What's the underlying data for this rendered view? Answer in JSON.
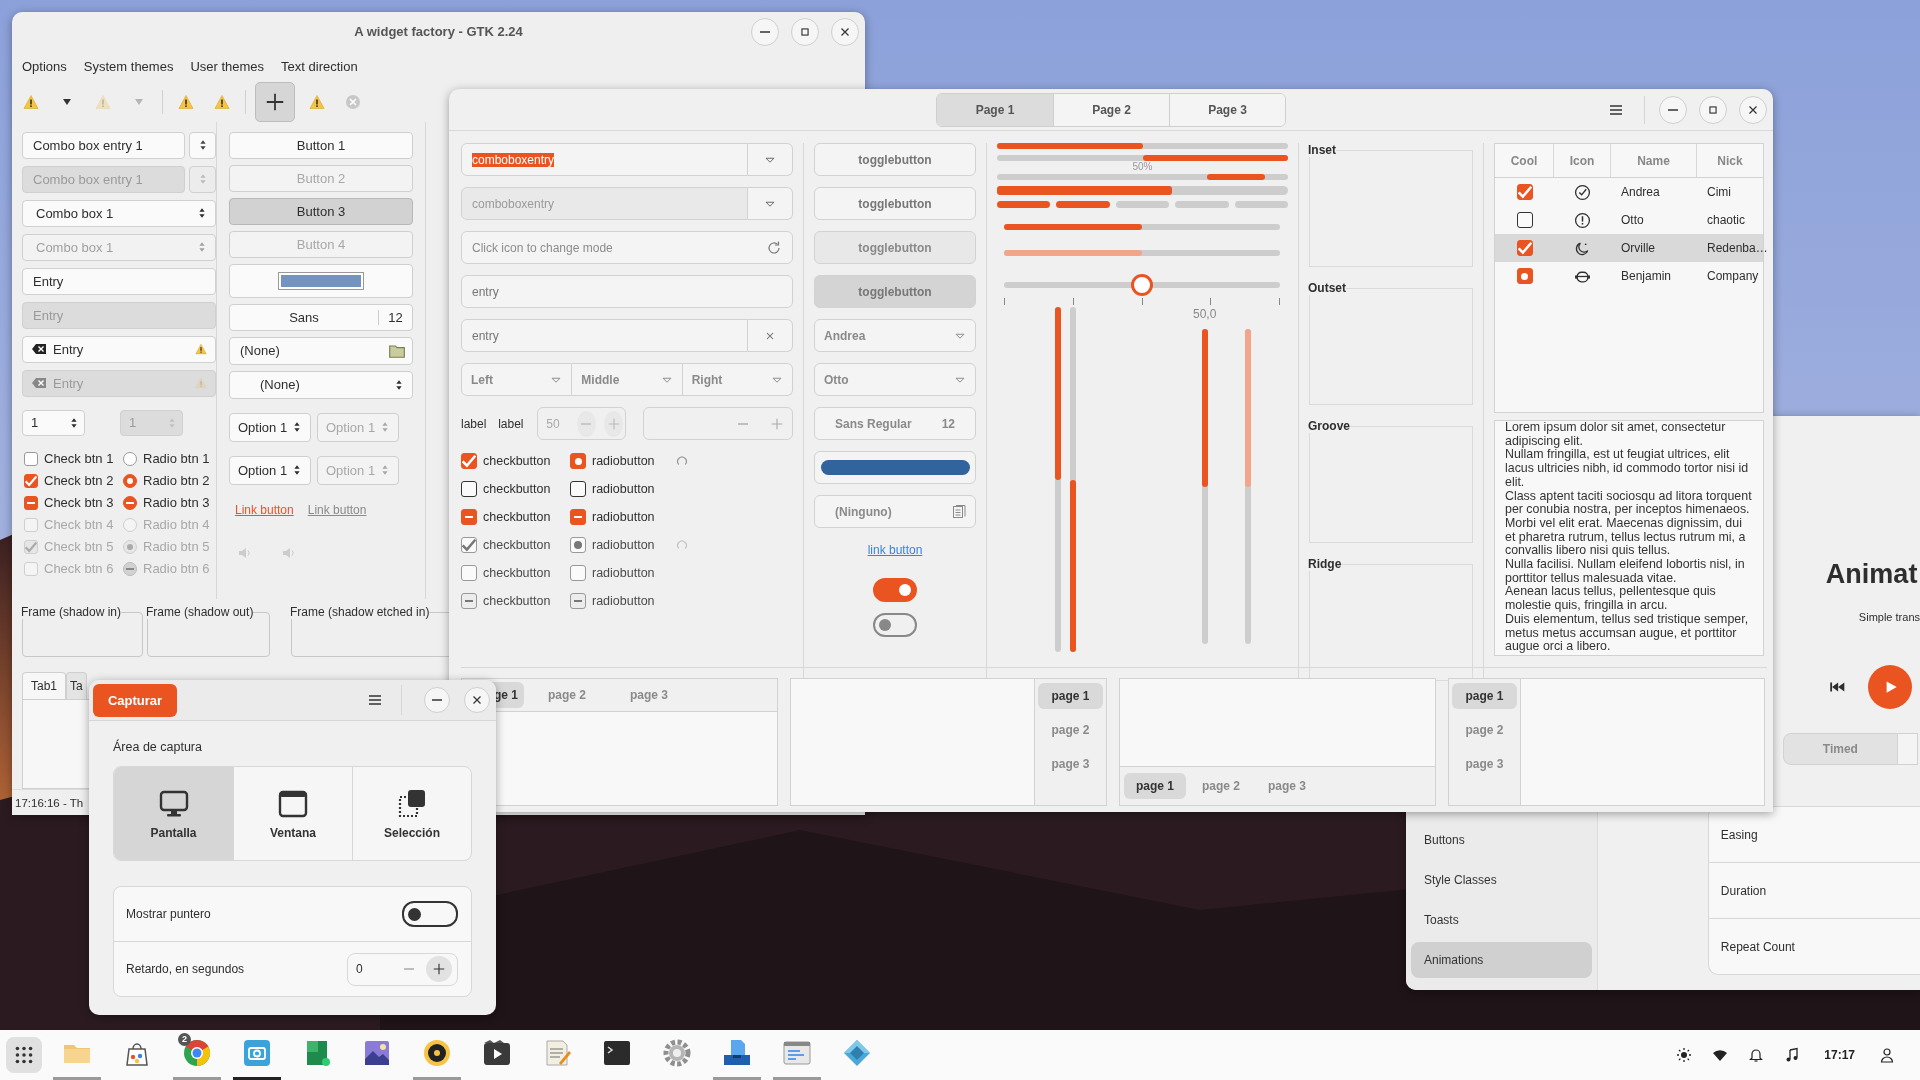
{
  "side_window": {
    "sidebar": [
      {
        "label": "Buttons",
        "selected": false
      },
      {
        "label": "Style Classes",
        "selected": false
      },
      {
        "label": "Toasts",
        "selected": false
      },
      {
        "label": "Animations",
        "selected": true
      }
    ],
    "heading": "Animat",
    "subtitle": "Simple trans",
    "segments": [
      {
        "label": "Timed",
        "selected": true
      }
    ],
    "rows": [
      "Easing",
      "Duration",
      "Repeat Count"
    ]
  },
  "gtk2_window": {
    "title": "A widget factory - GTK 2.24",
    "menu": [
      "Options",
      "System themes",
      "User themes",
      "Text direction"
    ],
    "toolbar": [
      {
        "items": [
          {
            "kind": "warning",
            "disabled": false,
            "pressed": false
          },
          {
            "kind": "arrow",
            "disabled": false,
            "pressed": false
          },
          {
            "kind": "warning",
            "disabled": true,
            "pressed": false
          },
          {
            "kind": "arrow",
            "disabled": true,
            "pressed": false
          }
        ]
      },
      {
        "items": [
          {
            "kind": "warning",
            "disabled": false,
            "pressed": false
          },
          {
            "kind": "warning",
            "disabled": false,
            "pressed": false
          }
        ]
      },
      {
        "items": [
          {
            "kind": "add",
            "disabled": false,
            "pressed": true
          },
          {
            "kind": "warning",
            "disabled": false,
            "pressed": false
          },
          {
            "kind": "stop",
            "disabled": false,
            "pressed": false
          }
        ]
      }
    ],
    "fields": [
      {
        "kind": "combo_entry",
        "value": "Combo box entry 1",
        "disabled": false
      },
      {
        "kind": "combo_entry",
        "value": "Combo box entry 1",
        "disabled": true
      },
      {
        "kind": "combo",
        "value": "Combo box 1",
        "disabled": false
      },
      {
        "kind": "combo",
        "value": "Combo box 1",
        "disabled": true
      },
      {
        "kind": "entry",
        "value": "Entry",
        "disabled": false
      },
      {
        "kind": "entry",
        "value": "Entry",
        "disabled": true
      },
      {
        "kind": "icon_entry",
        "value": "Entry",
        "disabled": false
      },
      {
        "kind": "icon_entry",
        "value": "Entry",
        "disabled": true
      }
    ],
    "spins": [
      {
        "value": "1",
        "disabled": false
      },
      {
        "value": "1",
        "disabled": true
      }
    ],
    "checks": [
      {
        "kind": "plain",
        "label": "Check btn 1",
        "checked": false,
        "disabled": false
      },
      {
        "kind": "plain",
        "label": "Check btn 2",
        "checked": true,
        "disabled": false
      },
      {
        "kind": "mixed",
        "label": "Check btn 3",
        "checked": true,
        "disabled": false
      },
      {
        "kind": "plain",
        "label": "Check btn 4",
        "checked": false,
        "disabled": true
      },
      {
        "kind": "plain",
        "label": "Check btn 5",
        "checked": true,
        "disabled": true
      },
      {
        "kind": "plain",
        "label": "Check btn 6",
        "checked": false,
        "disabled": true
      }
    ],
    "radios": [
      {
        "kind": "plain",
        "label": "Radio btn 1",
        "selected": false,
        "disabled": false
      },
      {
        "kind": "plain",
        "label": "Radio btn 2",
        "selected": true,
        "disabled": false
      },
      {
        "kind": "mixed",
        "label": "Radio btn 3",
        "selected": true,
        "disabled": false
      },
      {
        "kind": "plain",
        "label": "Radio btn 4",
        "selected": false,
        "disabled": true
      },
      {
        "kind": "plain",
        "label": "Radio btn 5",
        "selected": true,
        "disabled": true
      },
      {
        "kind": "mixed",
        "label": "Radio btn 6",
        "selected": true,
        "disabled": true
      }
    ],
    "buttons": [
      {
        "label": "Button 1",
        "disabled": false,
        "pressed": false
      },
      {
        "label": "Button 2",
        "disabled": true,
        "pressed": false
      },
      {
        "label": "Button 3",
        "disabled": false,
        "pressed": true
      },
      {
        "label": "Button 4",
        "disabled": true,
        "pressed": false
      }
    ],
    "font_button": {
      "family": "Sans",
      "size": "12"
    },
    "file_button": {
      "value": "(None)"
    },
    "combo": {
      "value": "(None)"
    },
    "option_spins": [
      {
        "value": "Option 1",
        "disabled": false
      },
      {
        "value": "Option 1",
        "disabled": true
      },
      {
        "value": "Option 1",
        "disabled": false
      },
      {
        "value": "Option 1",
        "disabled": true
      }
    ],
    "links": [
      {
        "label": "Link button",
        "visited": false
      },
      {
        "label": "Link button",
        "visited": true
      }
    ],
    "frames": [
      "Frame (shadow in)",
      "Frame (shadow out)",
      "Frame (shadow etched in)"
    ],
    "tabs": [
      {
        "label": "Tab1",
        "selected": true
      },
      {
        "label": "Ta",
        "selected": false
      }
    ],
    "status": "17:16:16 - Th"
  },
  "main_window": {
    "tabs": [
      {
        "label": "Page 1",
        "selected": true
      },
      {
        "label": "Page 2",
        "selected": false
      },
      {
        "label": "Page 3",
        "selected": false
      }
    ],
    "entries": [
      {
        "kind": "combo_entry",
        "value": "comboboxentry",
        "highlighted": true,
        "disabled": false
      },
      {
        "kind": "combo_entry",
        "value": "comboboxentry",
        "highlighted": false,
        "disabled": true
      },
      {
        "kind": "icon_entry",
        "placeholder": "Click icon to change mode",
        "disabled": false
      },
      {
        "kind": "entry",
        "placeholder": "entry",
        "disabled": false
      },
      {
        "kind": "clear_entry",
        "placeholder": "entry",
        "disabled": false
      }
    ],
    "linked_combos": [
      "Left",
      "Middle",
      "Right"
    ],
    "labels": [
      "label",
      "label"
    ],
    "spins": [
      {
        "value": "50",
        "disabled": true
      },
      {
        "disabled": true
      }
    ],
    "rows": [
      {
        "check": {
          "kind": "plain",
          "label": "checkbutton",
          "checked": true,
          "disabled": false
        },
        "radio": {
          "kind": "plain",
          "label": "radiobutton",
          "selected": true,
          "disabled": false
        },
        "spinner": true
      },
      {
        "check": {
          "kind": "plain",
          "label": "checkbutton",
          "checked": false,
          "disabled": false
        },
        "radio": {
          "kind": "plain",
          "label": "radiobutton",
          "selected": false,
          "disabled": false
        },
        "spinner": false
      },
      {
        "check": {
          "kind": "mixed",
          "label": "checkbutton",
          "checked": true,
          "disabled": false
        },
        "radio": {
          "kind": "mixed",
          "label": "radiobutton",
          "selected": true,
          "disabled": false
        },
        "spinner": false
      },
      {
        "check": {
          "kind": "plain",
          "label": "checkbutton",
          "checked": true,
          "disabled": true
        },
        "radio": {
          "kind": "plain",
          "label": "radiobutton",
          "selected": true,
          "disabled": true
        },
        "spinner": true
      },
      {
        "check": {
          "kind": "plain",
          "label": "checkbutton",
          "checked": false,
          "disabled": true
        },
        "radio": {
          "kind": "plain",
          "label": "radiobutton",
          "selected": false,
          "disabled": true
        },
        "spinner": false
      },
      {
        "check": {
          "kind": "mixed",
          "label": "checkbutton",
          "checked": true,
          "disabled": true
        },
        "radio": {
          "kind": "mixed",
          "label": "radiobutton",
          "selected": true,
          "disabled": true
        },
        "spinner": false
      }
    ],
    "toggles": [
      {
        "label": "togglebutton",
        "active": false,
        "disabled": false
      },
      {
        "label": "togglebutton",
        "active": false,
        "disabled": false
      },
      {
        "label": "togglebutton",
        "active": true,
        "disabled": true
      },
      {
        "label": "togglebutton",
        "active": true,
        "disabled": false
      }
    ],
    "combos": [
      "Andrea",
      "Otto"
    ],
    "font_button": {
      "family": "Sans Regular",
      "size": "12"
    },
    "file_button": {
      "value": "(Ninguno)"
    },
    "link": "link button",
    "switches": [
      {
        "on": true
      },
      {
        "on": false
      }
    ],
    "progress_bars": [
      {
        "level": 0.5,
        "inverted": false
      },
      {
        "level": 0.5,
        "inverted": true
      }
    ],
    "pulse_bar": {
      "label": "50%"
    },
    "wide_bar": {
      "level": 0.6
    },
    "segmented_bar": {
      "level": 0.4
    },
    "scales": [
      {
        "level": 0.5,
        "disabled": false
      },
      {
        "level": 0.5,
        "disabled": true
      }
    ],
    "slider": {
      "level": 0.5
    },
    "vertical_scales": [
      {
        "level": 0.5,
        "inverted": false,
        "disabled": false
      },
      {
        "level": 0.5,
        "inverted": true,
        "disabled": false
      },
      {
        "level": 0.5,
        "inverted": false,
        "disabled": false,
        "value": "50,0"
      },
      {
        "level": 0.5,
        "inverted": false,
        "disabled": true
      }
    ],
    "frames": [
      "Inset",
      "Outset",
      "Groove",
      "Ridge"
    ],
    "tree": {
      "columns": [
        "Cool",
        "Icon",
        "Name",
        "Nick"
      ],
      "rows": [
        {
          "kind": "check",
          "checked": true,
          "name": "Andrea",
          "nick": "Cimi",
          "selected": false
        },
        {
          "kind": "check",
          "checked": false,
          "name": "Otto",
          "nick": "chaotic",
          "selected": false
        },
        {
          "kind": "check",
          "checked": true,
          "name": "Orville",
          "nick": "Redenba…",
          "selected": true
        },
        {
          "kind": "radio",
          "checked": true,
          "name": "Benjamin",
          "nick": "Company",
          "selected": false
        }
      ]
    },
    "text_view": [
      "Lorem ipsum dolor sit amet, consectetur adipiscing elit.",
      "Nullam fringilla, est ut feugiat ultrices, elit lacus ultricies nibh, id commodo tortor nisi id elit.",
      "Class aptent taciti sociosqu ad litora torquent per conubia nostra, per inceptos himenaeos.",
      "Morbi vel elit erat. Maecenas dignissim, dui et pharetra rutrum, tellus lectus rutrum mi, a convallis libero nisi quis tellus.",
      "Nulla facilisi. Nullam eleifend lobortis nisl, in porttitor tellus malesuada vitae.",
      "Aenean lacus tellus, pellentesque quis molestie quis, fringilla in arcu.",
      "Duis elementum, tellus sed tristique semper, metus metus accumsan augue, et porttitor augue orci a libero."
    ],
    "notebooks": [
      {
        "kind": "top",
        "tabs": [
          {
            "label": "ge 1",
            "selected": true
          },
          {
            "label": "page 2",
            "selected": false
          },
          {
            "label": "page 3",
            "selected": false
          }
        ]
      },
      {
        "kind": "right",
        "tabs": [
          {
            "label": "page 1",
            "selected": true
          },
          {
            "label": "page 2",
            "selected": false
          },
          {
            "label": "page 3",
            "selected": false
          }
        ]
      },
      {
        "kind": "bottom",
        "tabs": [
          {
            "label": "page 1",
            "selected": true
          },
          {
            "label": "page 2",
            "selected": false
          },
          {
            "label": "page 3",
            "selected": false
          }
        ]
      },
      {
        "kind": "left",
        "tabs": [
          {
            "label": "page 1",
            "selected": true
          },
          {
            "label": "page 2",
            "selected": false
          },
          {
            "label": "page 3",
            "selected": false
          }
        ]
      }
    ]
  },
  "capture_window": {
    "capture_button": "Capturar",
    "section_title": "Área de captura",
    "modes": [
      {
        "label": "Pantalla",
        "selected": true
      },
      {
        "label": "Ventana",
        "selected": false
      },
      {
        "label": "Selección",
        "selected": false
      }
    ],
    "rows": [
      {
        "kind": "switch",
        "label": "Mostrar puntero",
        "on": false
      },
      {
        "kind": "spin",
        "label": "Retardo, en segundos",
        "value": "0"
      }
    ]
  },
  "taskbar": {
    "apps": [
      {
        "running": true,
        "focused": false
      },
      {
        "running": false,
        "focused": false
      },
      {
        "running": true,
        "focused": false,
        "badge": "2"
      },
      {
        "running": true,
        "focused": true
      },
      {
        "running": false,
        "focused": false
      },
      {
        "running": false,
        "focused": false
      },
      {
        "running": true,
        "focused": false
      },
      {
        "running": false,
        "focused": false
      },
      {
        "running": false,
        "focused": false
      },
      {
        "running": false,
        "focused": false
      },
      {
        "running": false,
        "focused": false
      },
      {
        "running": true,
        "focused": false
      },
      {
        "running": true,
        "focused": false
      },
      {
        "running": false,
        "focused": false
      }
    ],
    "clock": "17:17"
  }
}
